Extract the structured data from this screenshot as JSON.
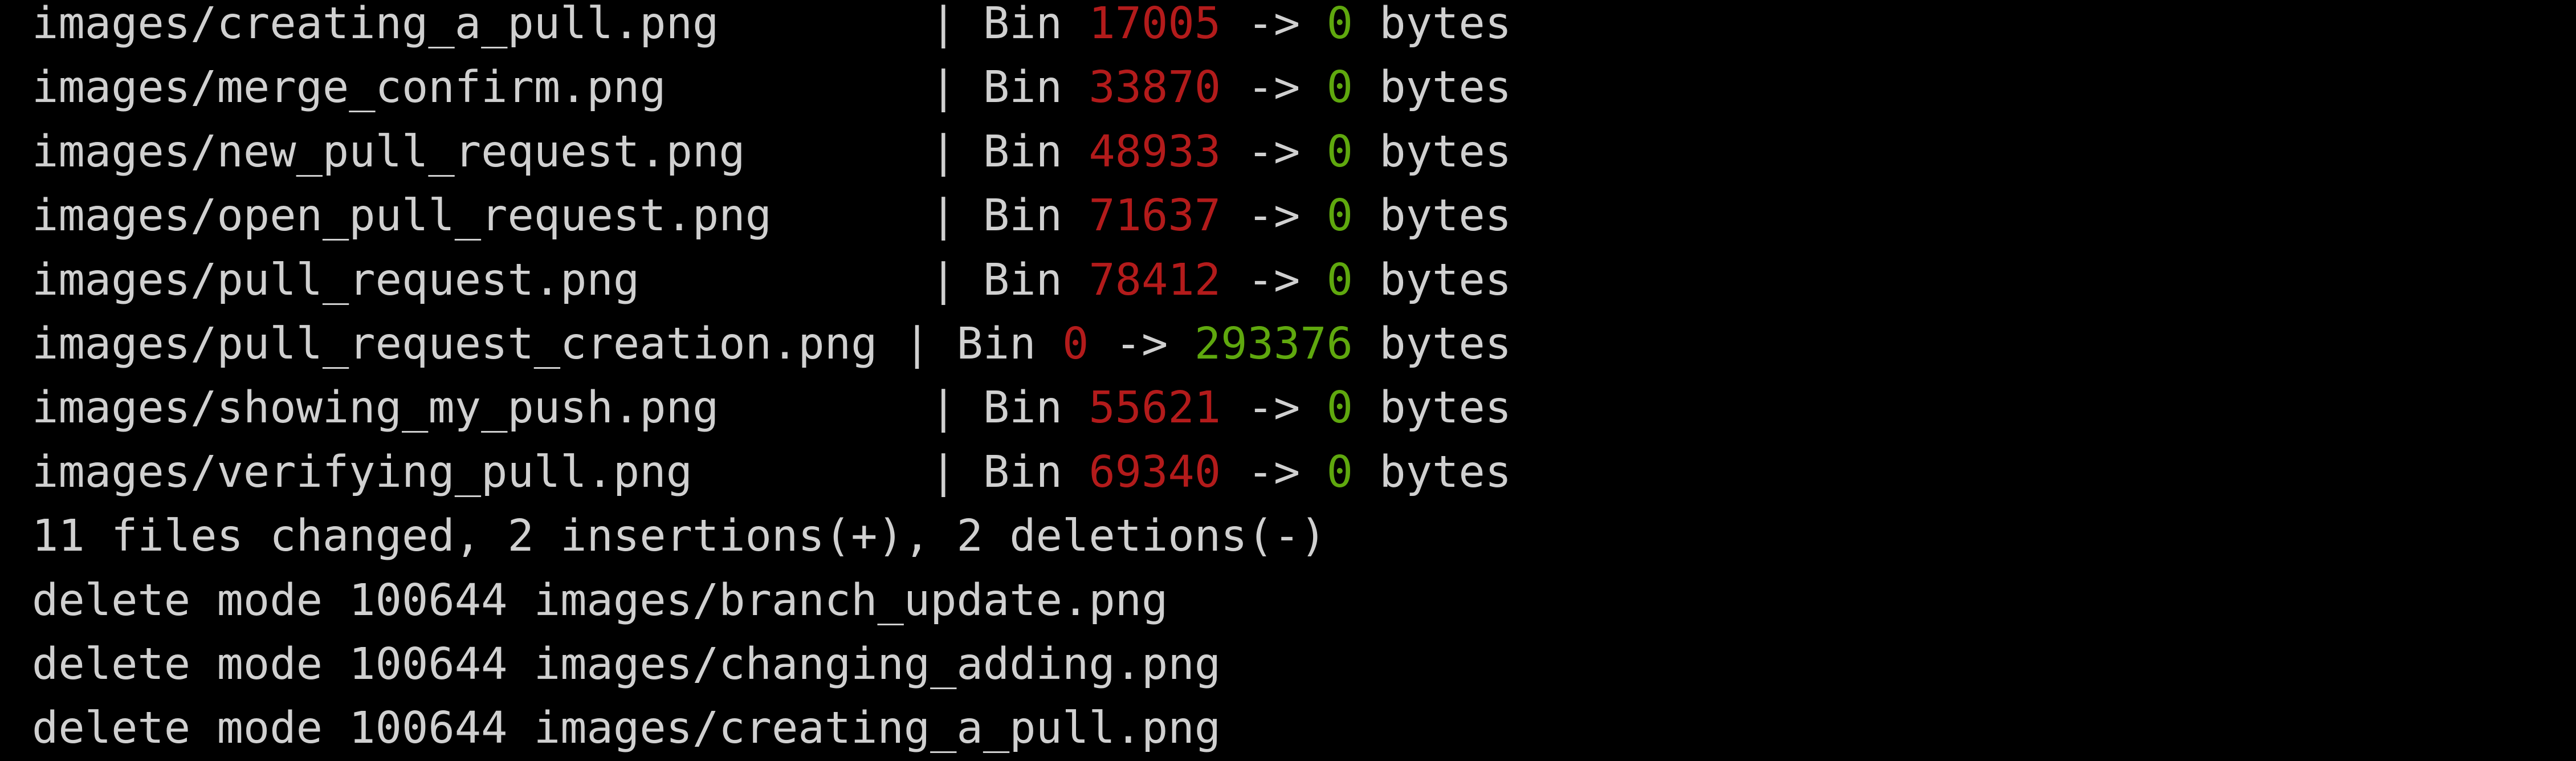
{
  "terminal": {
    "colors": {
      "background": "#000000",
      "foreground": "#d0d0d0",
      "deletions": "#b31b1b",
      "insertions": "#5fa80e"
    },
    "stat_rows": [
      {
        "file": "images/creating_a_pull.png        ",
        "sep": "| Bin ",
        "old": "17005",
        "arrow": " -> ",
        "new": "0",
        "unit": " bytes",
        "old_color": "red",
        "new_color": "green"
      },
      {
        "file": "images/merge_confirm.png          ",
        "sep": "| Bin ",
        "old": "33870",
        "arrow": " -> ",
        "new": "0",
        "unit": " bytes",
        "old_color": "red",
        "new_color": "green"
      },
      {
        "file": "images/new_pull_request.png       ",
        "sep": "| Bin ",
        "old": "48933",
        "arrow": " -> ",
        "new": "0",
        "unit": " bytes",
        "old_color": "red",
        "new_color": "green"
      },
      {
        "file": "images/open_pull_request.png      ",
        "sep": "| Bin ",
        "old": "71637",
        "arrow": " -> ",
        "new": "0",
        "unit": " bytes",
        "old_color": "red",
        "new_color": "green"
      },
      {
        "file": "images/pull_request.png           ",
        "sep": "| Bin ",
        "old": "78412",
        "arrow": " -> ",
        "new": "0",
        "unit": " bytes",
        "old_color": "red",
        "new_color": "green"
      },
      {
        "file": "images/pull_request_creation.png ",
        "sep": "| Bin ",
        "old": "0",
        "arrow": " -> ",
        "new": "293376",
        "unit": " bytes",
        "old_color": "red",
        "new_color": "green"
      },
      {
        "file": "images/showing_my_push.png        ",
        "sep": "| Bin ",
        "old": "55621",
        "arrow": " -> ",
        "new": "0",
        "unit": " bytes",
        "old_color": "red",
        "new_color": "green"
      },
      {
        "file": "images/verifying_pull.png         ",
        "sep": "| Bin ",
        "old": "69340",
        "arrow": " -> ",
        "new": "0",
        "unit": " bytes",
        "old_color": "red",
        "new_color": "green"
      }
    ],
    "summary": "11 files changed, 2 insertions(+), 2 deletions(-)",
    "delete_lines": [
      "delete mode 100644 images/branch_update.png",
      "delete mode 100644 images/changing_adding.png",
      "delete mode 100644 images/creating_a_pull.png"
    ]
  }
}
